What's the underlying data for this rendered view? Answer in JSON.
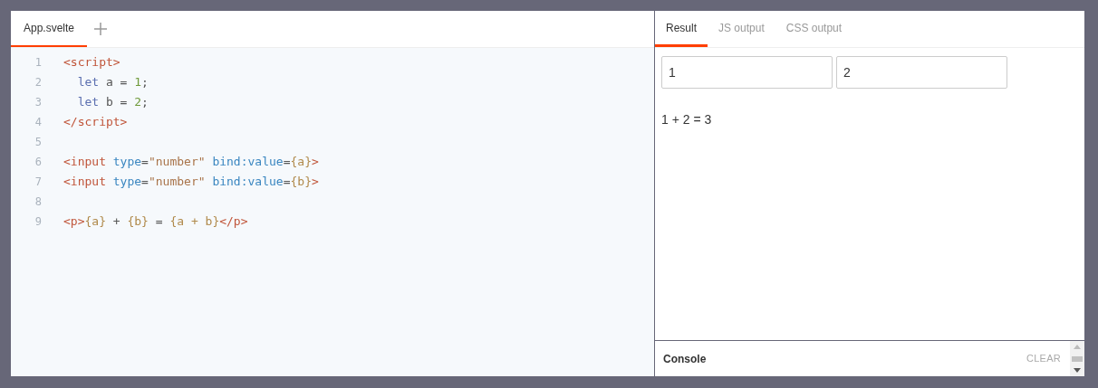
{
  "editor": {
    "tabs": [
      {
        "label": "App.svelte",
        "selected": true
      }
    ],
    "lines": [
      {
        "number": "1",
        "tokens": [
          {
            "text": "<script>",
            "kind": "tag"
          }
        ]
      },
      {
        "number": "2",
        "tokens": [
          {
            "text": "  let",
            "kind": "keyword"
          },
          {
            "text": " a = ",
            "kind": "plain"
          },
          {
            "text": "1",
            "kind": "number"
          },
          {
            "text": ";",
            "kind": "plain"
          }
        ]
      },
      {
        "number": "3",
        "tokens": [
          {
            "text": "  let",
            "kind": "keyword"
          },
          {
            "text": " b = ",
            "kind": "plain"
          },
          {
            "text": "2",
            "kind": "number"
          },
          {
            "text": ";",
            "kind": "plain"
          }
        ]
      },
      {
        "number": "4",
        "tokens": [
          {
            "text": "</script>",
            "kind": "tag"
          }
        ]
      },
      {
        "number": "5"
      },
      {
        "number": "6",
        "tokens": [
          {
            "text": "<input",
            "kind": "tag"
          },
          {
            "text": " type",
            "kind": "attr"
          },
          {
            "text": "=",
            "kind": "plain"
          },
          {
            "text": "\"number\"",
            "kind": "string"
          },
          {
            "text": " bind:value",
            "kind": "attr"
          },
          {
            "text": "=",
            "kind": "plain"
          },
          {
            "text": "{a}",
            "kind": "expr"
          },
          {
            "text": ">",
            "kind": "tag"
          }
        ]
      },
      {
        "number": "7",
        "tokens": [
          {
            "text": "<input",
            "kind": "tag"
          },
          {
            "text": " type",
            "kind": "attr"
          },
          {
            "text": "=",
            "kind": "plain"
          },
          {
            "text": "\"number\"",
            "kind": "string"
          },
          {
            "text": " bind:value",
            "kind": "attr"
          },
          {
            "text": "=",
            "kind": "plain"
          },
          {
            "text": "{b}",
            "kind": "expr"
          },
          {
            "text": ">",
            "kind": "tag"
          }
        ]
      },
      {
        "number": "8"
      },
      {
        "number": "9",
        "tokens": [
          {
            "text": "<p>",
            "kind": "tag"
          },
          {
            "text": "{a}",
            "kind": "expr"
          },
          {
            "text": " + ",
            "kind": "plain"
          },
          {
            "text": "{b}",
            "kind": "expr"
          },
          {
            "text": " = ",
            "kind": "plain"
          },
          {
            "text": "{a + b}",
            "kind": "expr"
          },
          {
            "text": "</p>",
            "kind": "tag"
          }
        ]
      }
    ]
  },
  "output": {
    "tabs": [
      {
        "label": "Result",
        "selected": true
      },
      {
        "label": "JS output",
        "selected": false
      },
      {
        "label": "CSS output",
        "selected": false
      }
    ],
    "inputs": [
      {
        "value": "1"
      },
      {
        "value": "2"
      }
    ],
    "result_text": "1 + 2 = 3",
    "console": {
      "title": "Console",
      "clear_button": "CLEAR"
    }
  }
}
